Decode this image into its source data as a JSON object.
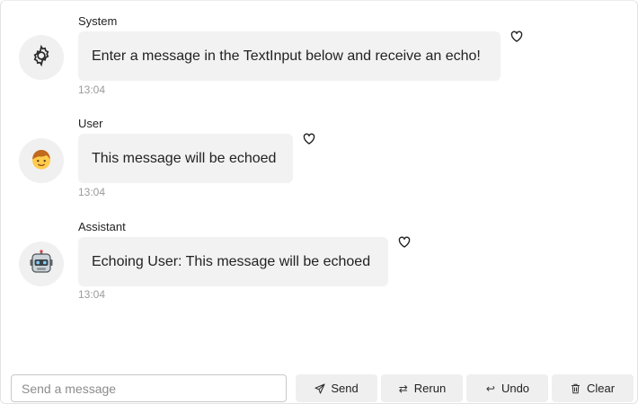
{
  "messages": [
    {
      "sender": "System",
      "avatar_icon": "gear-icon",
      "text": "Enter a message in the TextInput below and receive an echo!",
      "time": "13:04"
    },
    {
      "sender": "User",
      "avatar_icon": "person-emoji-icon",
      "text": "This message will be echoed",
      "time": "13:04"
    },
    {
      "sender": "Assistant",
      "avatar_icon": "robot-icon",
      "text": "Echoing User: This message will be echoed",
      "time": "13:04"
    }
  ],
  "composer": {
    "placeholder": "Send a message",
    "value": "",
    "send_label": "Send",
    "rerun_label": "Rerun",
    "undo_label": "Undo",
    "clear_label": "Clear"
  },
  "icons": {
    "like": "heart-outline-icon",
    "send": "send-icon",
    "rerun": "rerun-icon",
    "undo": "undo-icon",
    "clear": "trash-icon"
  }
}
